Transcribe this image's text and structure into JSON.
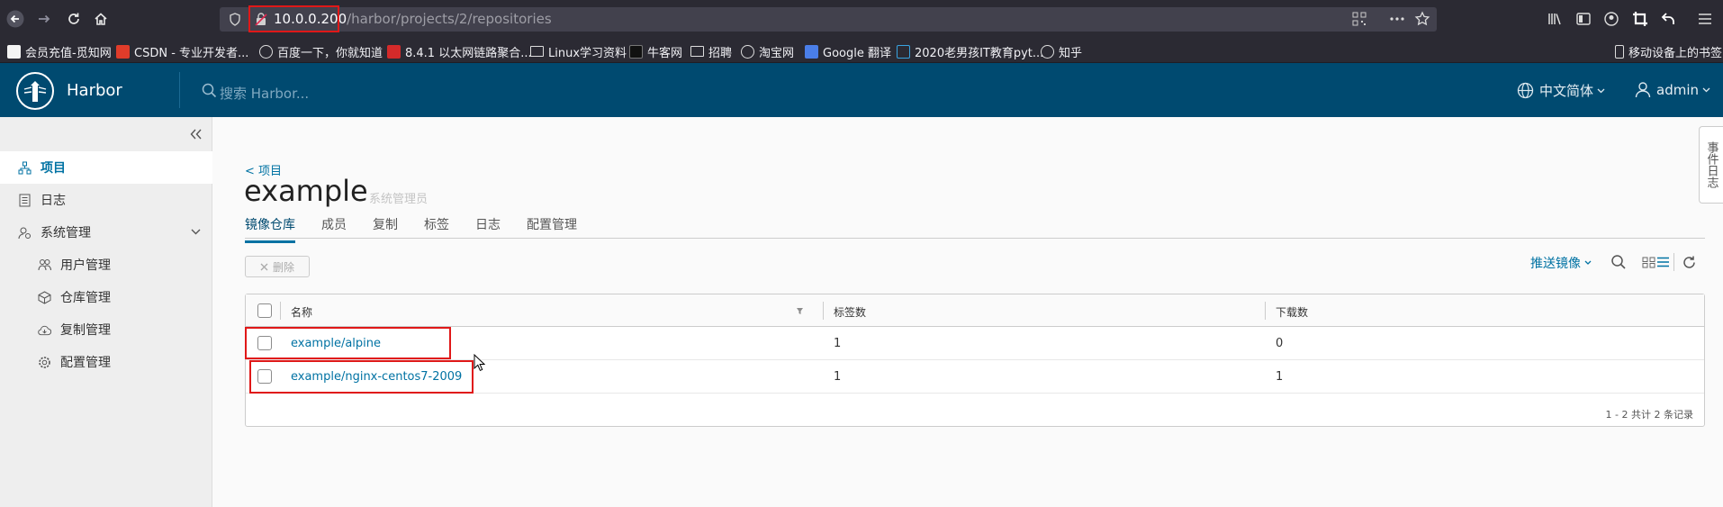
{
  "browser": {
    "url_host": "10.0.0.200",
    "url_path": "/harbor/projects/2/repositories",
    "bookmarks": [
      "会员充值-觅知网",
      "CSDN - 专业开发者...",
      "百度一下，你就知道",
      "8.4.1 以太网链路聚合...",
      "Linux学习资料",
      "牛客网",
      "招聘",
      "淘宝网",
      "Google 翻译",
      "2020老男孩IT教育pyt...",
      "知乎"
    ],
    "mobile_bookmarks": "移动设备上的书签"
  },
  "header": {
    "brand": "Harbor",
    "search_placeholder": "搜索 Harbor...",
    "language": "中文简体",
    "user": "admin"
  },
  "sidebar": {
    "items": [
      {
        "label": "项目",
        "icon": "projects-icon"
      },
      {
        "label": "日志",
        "icon": "log-icon"
      },
      {
        "label": "系统管理",
        "icon": "admin-icon"
      },
      {
        "label": "用户管理",
        "icon": "users-icon"
      },
      {
        "label": "仓库管理",
        "icon": "registry-icon"
      },
      {
        "label": "复制管理",
        "icon": "replication-icon"
      },
      {
        "label": "配置管理",
        "icon": "config-icon"
      }
    ]
  },
  "right_tab": "事件日志",
  "project": {
    "back_link": "< 项目",
    "name": "example",
    "role": "系统管理员",
    "tabs": [
      "镜像仓库",
      "成员",
      "复制",
      "标签",
      "日志",
      "配置管理"
    ]
  },
  "toolbar": {
    "delete": "删除",
    "push": "推送镜像"
  },
  "table": {
    "columns": [
      "名称",
      "标签数",
      "下载数"
    ],
    "rows": [
      {
        "name": "example/alpine",
        "tags": "1",
        "pulls": "0"
      },
      {
        "name": "example/nginx-centos7-2009",
        "tags": "1",
        "pulls": "1"
      }
    ],
    "footer": "1 - 2 共计 2 条记录"
  },
  "colors": {
    "header_bg": "#004a70",
    "link": "#0072a3",
    "annotation": "#e01818"
  }
}
